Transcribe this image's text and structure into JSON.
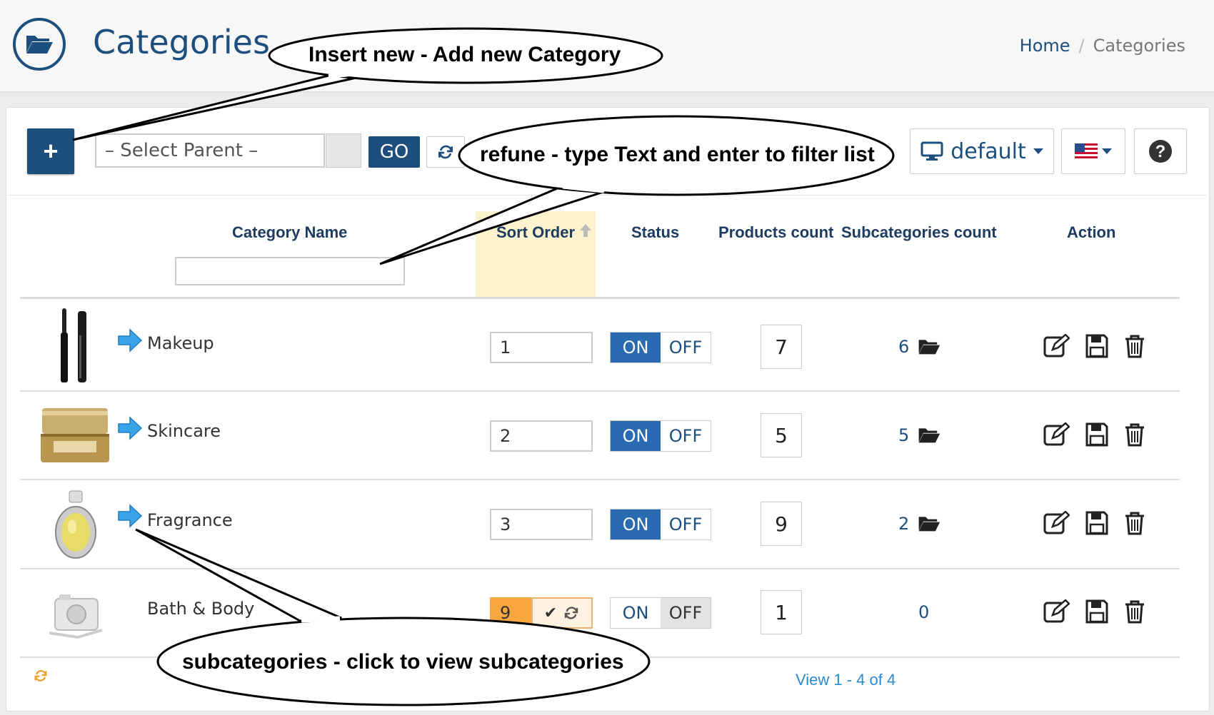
{
  "header": {
    "title": "Categories",
    "breadcrumb": {
      "home": "Home",
      "separator": "/",
      "current": "Categories"
    }
  },
  "toolbar": {
    "add_label": "+",
    "parent_select": "– Select Parent –",
    "go_label": "GO",
    "template_label": "default"
  },
  "table": {
    "headers": {
      "name": "Category Name",
      "sort": "Sort Order",
      "status": "Status",
      "products": "Products count",
      "subcategories": "Subcategories count",
      "action": "Action"
    },
    "on_label": "ON",
    "off_label": "OFF",
    "rows": [
      {
        "name": "Makeup",
        "sort": "1",
        "status": "on",
        "products": "7",
        "subcategories": "6"
      },
      {
        "name": "Skincare",
        "sort": "2",
        "status": "on",
        "products": "5",
        "subcategories": "5"
      },
      {
        "name": "Fragrance",
        "sort": "3",
        "status": "on",
        "products": "9",
        "subcategories": "2"
      },
      {
        "name": "Bath & Body",
        "sort": "9",
        "status": "off",
        "products": "1",
        "subcategories": "0"
      }
    ]
  },
  "pager": {
    "text": "View 1 - 4 of 4"
  },
  "callouts": {
    "insert": "Insert new - Add new Category",
    "refine": "refune - type Text and enter to filter list",
    "subcategories": "subcategories - click to view subcategories"
  },
  "colors": {
    "primary": "#1d4f7e",
    "on": "#2a6ab0",
    "sort_highlight": "#fdf3cf",
    "edited": "#f7a640"
  }
}
